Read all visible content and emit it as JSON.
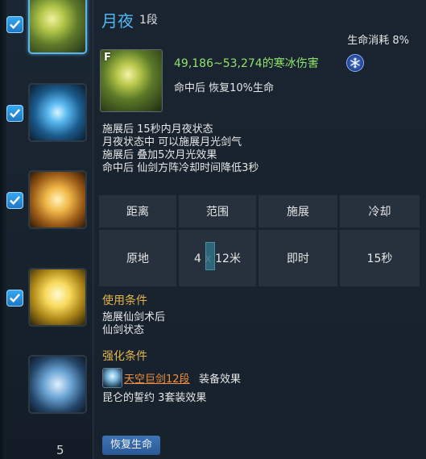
{
  "skill_list": {
    "bottom_count": "5",
    "items": [
      {
        "checked": true,
        "icon": "moon-sword-skill-icon"
      },
      {
        "checked": true,
        "icon": "frost-sword-skill-icon"
      },
      {
        "checked": true,
        "icon": "golden-sword-skill-icon"
      },
      {
        "checked": true,
        "icon": "crossed-swords-skill-icon"
      },
      {
        "checked": false,
        "icon": "ice-sword-skill-icon"
      }
    ]
  },
  "tooltip": {
    "name": "月夜",
    "rank": "1段",
    "cost": "生命消耗 8%",
    "key": "F",
    "damage": "49,186~53,274的寒冰伤害",
    "damage_color": "#8fe36a",
    "on_hit_heal": "命中后 恢复10%生命",
    "description": [
      "施展后 15秒内月夜状态",
      "月夜状态中 可以施展月光剑气",
      "施展后 叠加5次月光效果",
      "命中后 仙剑方阵冷却时间降低3秒"
    ],
    "stats": {
      "headers": [
        "距离",
        "范围",
        "施展",
        "冷却"
      ],
      "values": [
        "原地",
        "4 x 12米",
        "即时",
        "15秒"
      ]
    },
    "use_condition": {
      "title": "使用条件",
      "lines": [
        "施展仙剑术后",
        "仙剑状态"
      ]
    },
    "enhance_condition": {
      "title": "强化条件",
      "gear_link": "天空巨剑12段",
      "gear_suffix": "装备效果",
      "set_effect": "昆仑的誓约 3套装效果"
    },
    "tag": "恢复生命"
  }
}
